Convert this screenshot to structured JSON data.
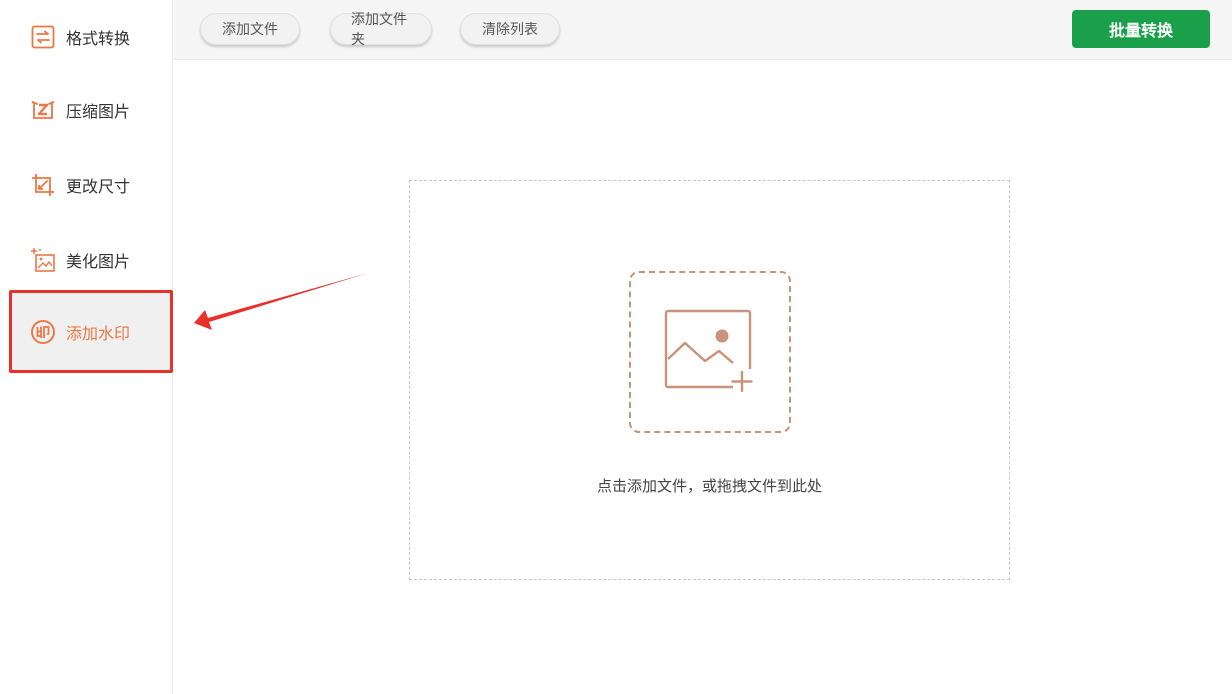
{
  "sidebar": {
    "items": [
      {
        "label": "格式转换",
        "icon": "format-convert-icon"
      },
      {
        "label": "压缩图片",
        "icon": "compress-icon"
      },
      {
        "label": "更改尺寸",
        "icon": "resize-icon"
      },
      {
        "label": "美化图片",
        "icon": "beautify-icon"
      },
      {
        "label": "添加水印",
        "icon": "watermark-icon",
        "active": true
      }
    ]
  },
  "toolbar": {
    "add_file": "添加文件",
    "add_folder": "添加文件夹",
    "clear_list": "清除列表",
    "batch_convert": "批量转换"
  },
  "dropzone": {
    "hint": "点击添加文件，或拖拽文件到此处",
    "icon": "add-image-icon"
  },
  "colors": {
    "accent": "#ec7744",
    "primary_button": "#1aa04a",
    "highlight": "#e8312a",
    "dropzone_icon": "#c8937a"
  }
}
